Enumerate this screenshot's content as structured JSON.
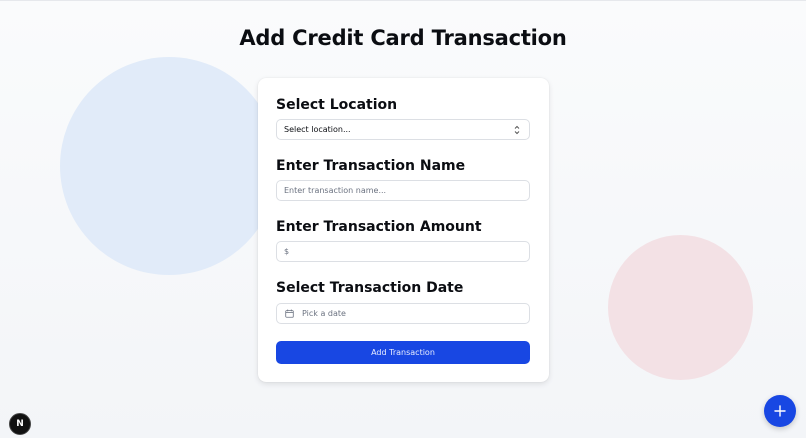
{
  "page": {
    "title": "Add Credit Card Transaction"
  },
  "form": {
    "location": {
      "label": "Select Location",
      "value": "Select location..."
    },
    "name": {
      "label": "Enter Transaction Name",
      "placeholder": "Enter transaction name..."
    },
    "amount": {
      "label": "Enter Transaction Amount",
      "prefix": "$"
    },
    "date": {
      "label": "Select Transaction Date",
      "placeholder": "Pick a date"
    },
    "submit_label": "Add Transaction"
  },
  "dev_badge": {
    "letter": "N"
  },
  "icons": {
    "select": "chevron-up-down-icon",
    "date": "calendar-icon",
    "fab": "plus-icon"
  },
  "colors": {
    "primary": "#1847e3",
    "blob_blue": "#e1ebf9",
    "blob_pink": "#f3e1e5"
  }
}
